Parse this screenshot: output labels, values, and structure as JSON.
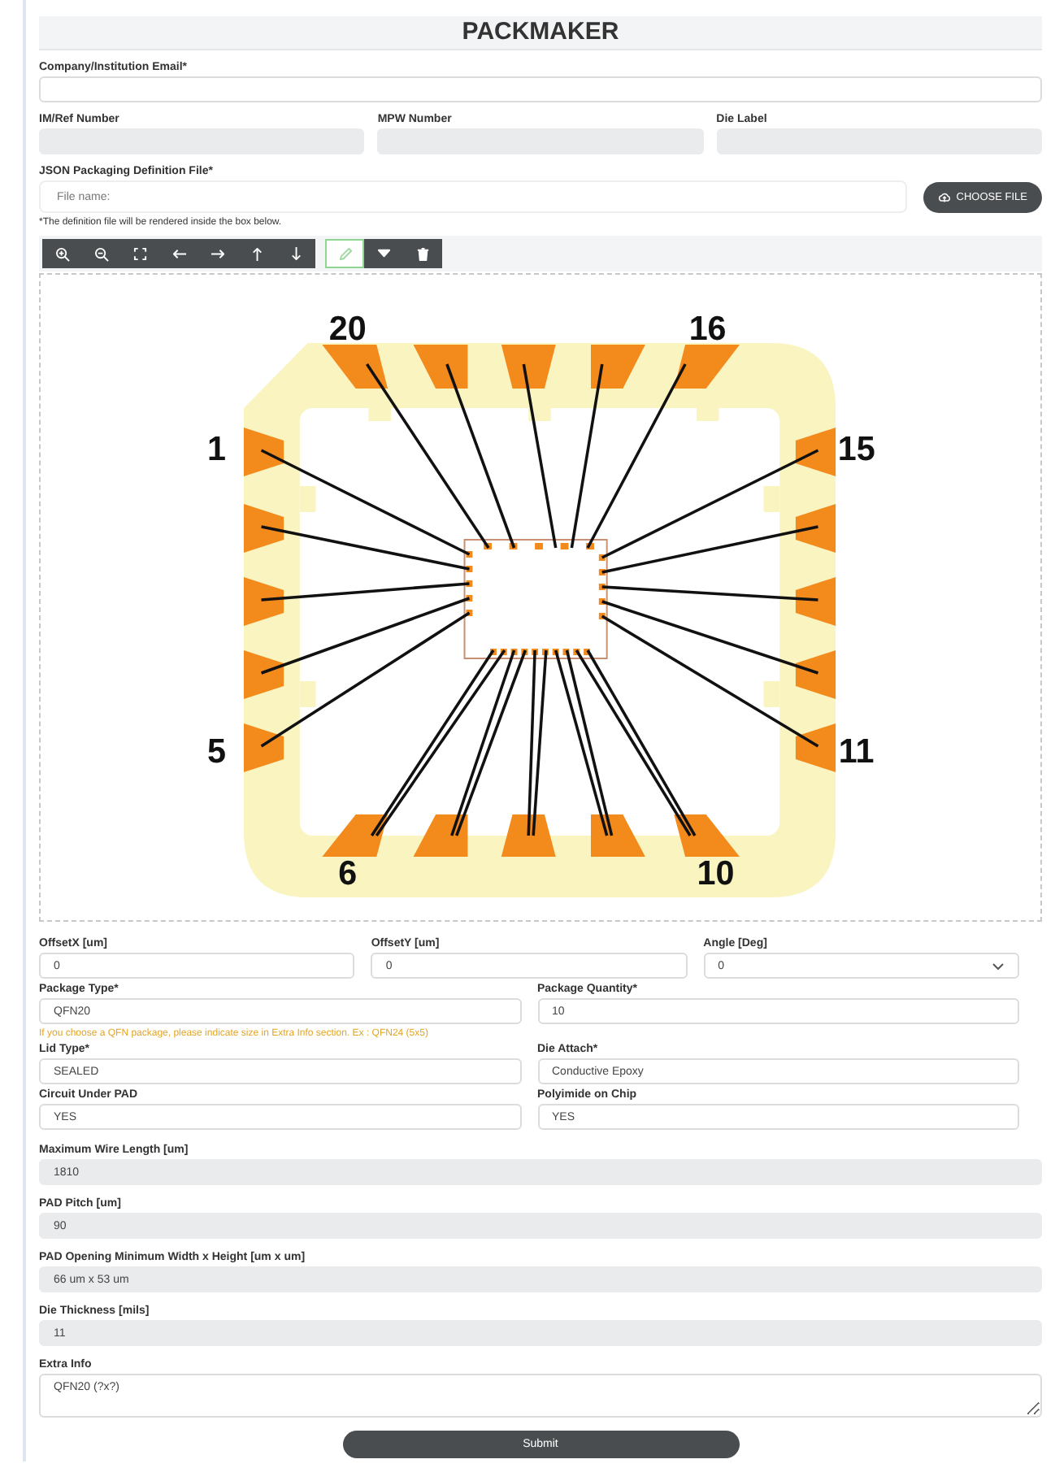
{
  "title": "PACKMAKER",
  "header_rows": [
    [
      {
        "label": "Company/Institution Email*",
        "disabled": false
      }
    ],
    [
      {
        "label": "IM/Ref Number",
        "disabled": true
      },
      {
        "label": "MPW Number",
        "disabled": true
      },
      {
        "label": "Die Label",
        "disabled": true
      }
    ]
  ],
  "file_input": {
    "label": "JSON Packaging Definition File*",
    "placeholder": "File name:",
    "button": "CHOOSE FILE",
    "note": "*The definition file will be rendered inside the box below."
  },
  "toolbar": [
    {
      "kind": "zoom-in",
      "selected": false
    },
    {
      "kind": "zoom-out",
      "selected": false
    },
    {
      "kind": "fit",
      "selected": false
    },
    {
      "kind": "left",
      "selected": false
    },
    {
      "kind": "right",
      "selected": false
    },
    {
      "kind": "up",
      "selected": false
    },
    {
      "kind": "down",
      "selected": false
    },
    {
      "kind": "pencil",
      "selected": true
    },
    {
      "kind": "filter",
      "selected": false
    },
    {
      "kind": "trash",
      "selected": false
    }
  ],
  "diagram": {
    "pin_labels": [
      "20",
      "16",
      "1",
      "15",
      "5",
      "11",
      "6",
      "10"
    ]
  },
  "settings": [
    {
      "kind": "fields",
      "fields": [
        {
          "kind": "text",
          "label": "OffsetX [um]",
          "value": "0",
          "disabled": false
        },
        {
          "kind": "text",
          "label": "OffsetY [um]",
          "value": "0",
          "disabled": false
        },
        {
          "kind": "select",
          "label": "Angle [Deg]",
          "value": "0",
          "disabled": false
        }
      ]
    },
    {
      "kind": "fields",
      "fields": [
        {
          "kind": "text",
          "label": "Package Type*",
          "value": "QFN20",
          "disabled": false
        },
        {
          "kind": "text",
          "label": "Package Quantity*",
          "value": "10",
          "disabled": false
        }
      ]
    },
    {
      "kind": "warning",
      "text": "If you choose a QFN package, please indicate size in Extra Info section. Ex : QFN24 (5x5)"
    },
    {
      "kind": "fields",
      "fields": [
        {
          "kind": "text",
          "label": "Lid Type*",
          "value": "SEALED",
          "disabled": false
        },
        {
          "kind": "text",
          "label": "Die Attach*",
          "value": "Conductive Epoxy",
          "disabled": false
        }
      ]
    },
    {
      "kind": "fields",
      "fields": [
        {
          "kind": "text",
          "label": "Circuit Under PAD",
          "value": "YES",
          "disabled": false
        },
        {
          "kind": "text",
          "label": "Polyimide on Chip",
          "value": "YES",
          "disabled": false
        }
      ]
    }
  ],
  "details": [
    {
      "kind": "text",
      "label": "Maximum Wire Length [um]",
      "value": "1810",
      "disabled": true
    },
    {
      "kind": "text",
      "label": "PAD Pitch [um]",
      "value": "90",
      "disabled": true
    },
    {
      "kind": "text",
      "label": "PAD Opening Minimum Width x Height [um x um]",
      "value": "66 um x 53 um",
      "disabled": true
    },
    {
      "kind": "text",
      "label": "Die Thickness [mils]",
      "value": "11",
      "disabled": true
    },
    {
      "kind": "textarea",
      "label": "Extra Info",
      "value": "QFN20 (?x?)",
      "disabled": false
    }
  ],
  "submit": "Submit"
}
